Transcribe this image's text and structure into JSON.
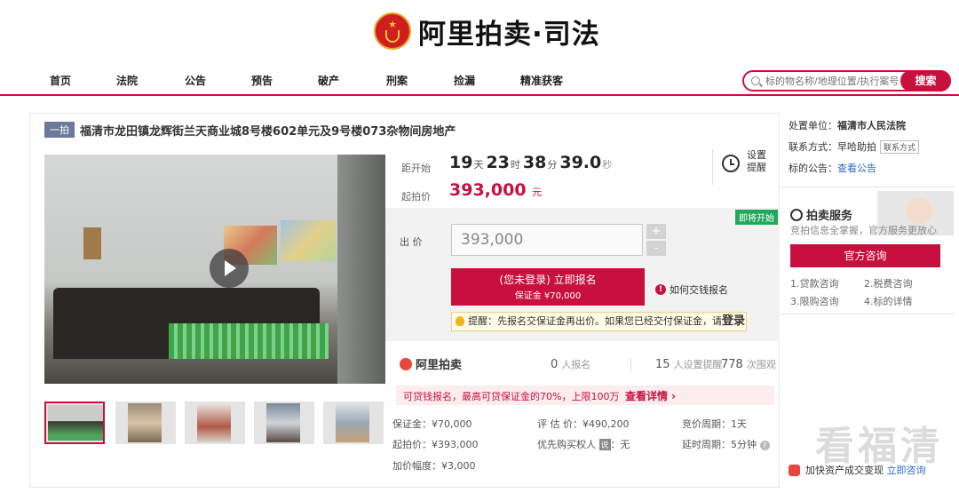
{
  "header": {
    "logo_text": "阿里拍卖·司法",
    "nav": [
      "首页",
      "法院",
      "公告",
      "预告",
      "破产",
      "刑案",
      "捡漏",
      "精准获客"
    ],
    "search": {
      "placeholder": "标的物名称/地理位置/执行案号",
      "button": "搜索"
    }
  },
  "item": {
    "round_tag": "一拍",
    "title": "福清市龙田镇龙辉街兰天商业城8号楼602单元及9号楼073杂物间房地产"
  },
  "countdown": {
    "label": "距开始",
    "days": "19",
    "day_unit": "天",
    "hours": "23",
    "hour_unit": "时",
    "minutes": "38",
    "minute_unit": "分",
    "seconds": "39.0",
    "second_unit": "秒",
    "remind_label": "设置提醒"
  },
  "start_price": {
    "label": "起拍价",
    "value": "393,000",
    "unit": "元"
  },
  "bid": {
    "soon_badge": "即将开始",
    "label": "出 价",
    "value": "393,000",
    "plus": "+",
    "minus": "-",
    "signup_line1": "(您未登录) 立即报名",
    "signup_line2": "保证金 ¥70,000",
    "how_to_pay": "如何交钱报名",
    "tip_text": "提醒：先报名交保证金再出价。如果您已经交付保证金，请",
    "tip_login": "登录"
  },
  "stats": {
    "brand": "阿里拍卖",
    "signups": "0",
    "signups_label": "人报名",
    "reminders": "15",
    "reminders_label": "人设置提醒",
    "views": "778",
    "views_label": "次围观"
  },
  "loan": {
    "text": "可贷钱报名，最高可贷保证金的70%，上限100万",
    "link": "查看详情 ›"
  },
  "details": {
    "deposit": "保证金：¥70,000",
    "appraisal": "评 估 价：¥490,200",
    "period": "竞价周期：1天",
    "start": "起拍价：¥393,000",
    "priority_label": "优先购买权人",
    "priority_tag": "说",
    "priority_value": "：无",
    "delay": "延时周期：5分钟",
    "increment": "加价幅度：¥3,000"
  },
  "sidebar": {
    "unit_label": "处置单位：",
    "unit_value": "福清市人民法院",
    "contact_label": "联系方式：",
    "contact_value": "早哈助拍",
    "contact_tag": "联系方式",
    "notice_label": "标的公告：",
    "notice_link": "查看公告",
    "service_title": "拍卖服务",
    "service_sub": "竞拍信息全掌握，官方服务更放心",
    "official_button": "官方咨询",
    "consults": [
      "1.贷款咨询",
      "2.税费咨询",
      "3.限购咨询",
      "4.标的详情"
    ],
    "footer": "加快资产成交变现",
    "footer_link": "立即咨询"
  },
  "watermark": "看福清"
}
